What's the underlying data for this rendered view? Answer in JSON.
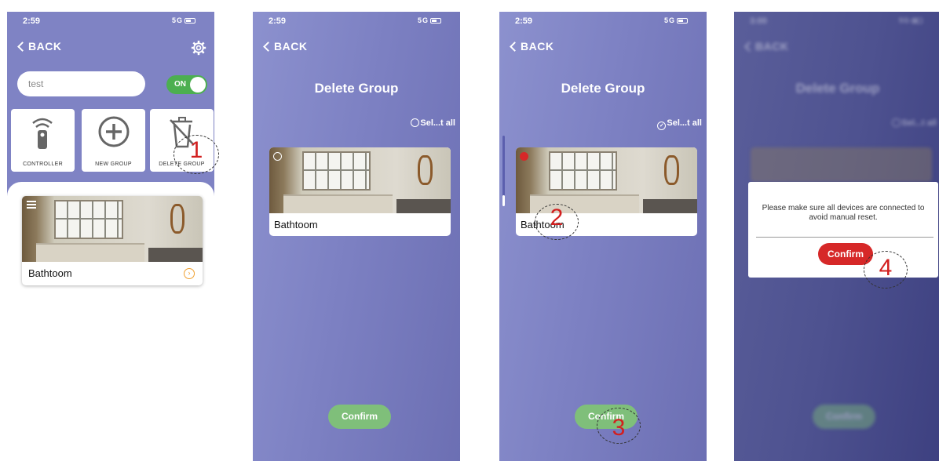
{
  "screens": [
    {
      "time": "2:59",
      "signal": "5G",
      "back_label": "BACK",
      "search_value": "test",
      "toggle_label": "ON",
      "tiles": [
        "CONTROLLER",
        "NEW GROUP",
        "DELETE GROUP"
      ],
      "group_card": {
        "name": "Bathtoom"
      }
    },
    {
      "time": "2:59",
      "signal": "5G",
      "back_label": "BACK",
      "title": "Delete Group",
      "select_all": "Sel...t all",
      "group_card": {
        "name": "Bathtoom"
      },
      "confirm_label": "Confirm"
    },
    {
      "time": "2:59",
      "signal": "5G",
      "back_label": "BACK",
      "title": "Delete Group",
      "select_all": "Sel...t all",
      "group_card": {
        "name": "Bathtoom"
      },
      "confirm_label": "Confirm"
    },
    {
      "time": "3:00",
      "signal": "5G",
      "back_label": "BACK",
      "title": "Delete Group",
      "select_all": "Sel...t all",
      "dialog_message": "Please make sure all devices are connected to avoid manual reset.",
      "dialog_confirm": "Confirm",
      "confirm_label": "Confirm"
    }
  ],
  "annotations": [
    "1",
    "2",
    "3",
    "4"
  ],
  "colors": {
    "accent_purple": "#7f83c4",
    "toggle_green": "#4caf50",
    "confirm_green": "#7fbf7a",
    "confirm_red": "#d62828",
    "annotation_red": "#d21f1f"
  },
  "icons": [
    "gear-icon",
    "remote-icon",
    "plus-icon",
    "trash-icon",
    "chevron-left-icon",
    "chevron-right-icon",
    "menu-icon"
  ]
}
